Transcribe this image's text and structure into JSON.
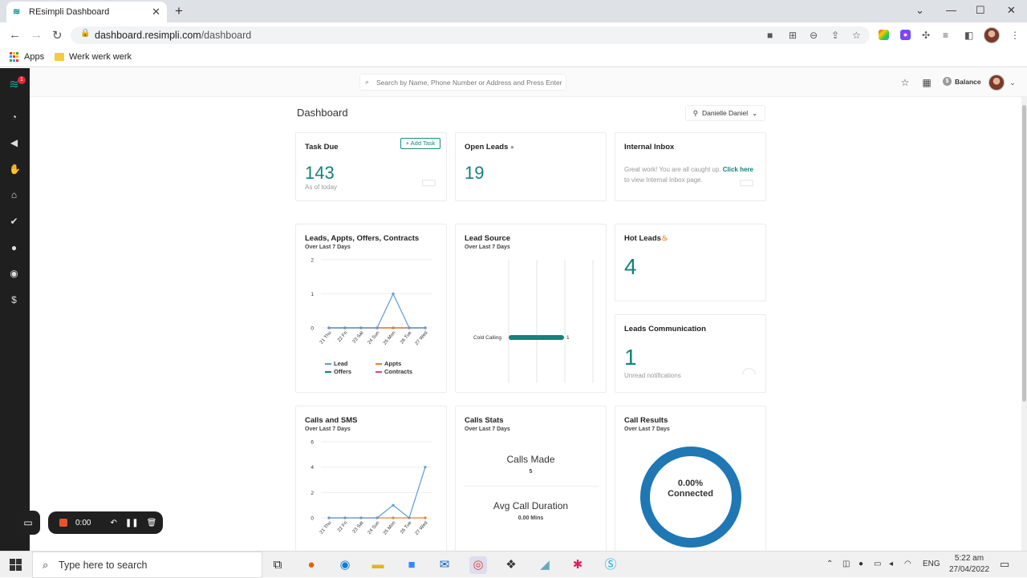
{
  "browser": {
    "tab_title": "REsimpli Dashboard",
    "url_host": "dashboard.resimpli.com",
    "url_path": "/dashboard",
    "bookmarks": [
      {
        "label": "Apps"
      },
      {
        "label": "Werk werk werk"
      }
    ]
  },
  "app": {
    "search_placeholder": "Search by Name, Phone Number or Address and Press Enter",
    "balance_label": "Balance",
    "notification_count": "1",
    "page_title": "Dashboard",
    "user_name": "Danielle Daniel"
  },
  "cards": {
    "task_due": {
      "title": "Task Due",
      "add_label": "+ Add Task",
      "value": "143",
      "sub": "As of today"
    },
    "open_leads": {
      "title": "Open Leads",
      "value": "19"
    },
    "internal_inbox": {
      "title": "Internal Inbox",
      "text_before": "Great work! You are all caught up. ",
      "link": "Click here",
      "text_after": " to view Internal Inbox page."
    },
    "leads_appts": {
      "title": "Leads, Appts, Offers, Contracts",
      "sub": "Over Last 7 Days"
    },
    "lead_source": {
      "title": "Lead Source",
      "sub": "Over Last 7 Days"
    },
    "hot_leads": {
      "title": "Hot Leads",
      "value": "4"
    },
    "leads_comm": {
      "title": "Leads Communication",
      "value": "1",
      "sub": "Unread notifications"
    },
    "calls_sms": {
      "title": "Calls and SMS",
      "sub": "Over Last 7 Days"
    },
    "calls_stats": {
      "title": "Calls Stats",
      "sub": "Over Last 7 Days",
      "made_label": "Calls Made",
      "made_value": "5",
      "duration_label": "Avg Call Duration",
      "duration_value": "0.00 Mins"
    },
    "call_results": {
      "title": "Call Results",
      "sub": "Over Last 7 Days",
      "pct": "0.00%",
      "label": "Connected"
    }
  },
  "chart_data": [
    {
      "type": "line",
      "title": "Leads, Appts, Offers, Contracts",
      "categories": [
        "21 Thu",
        "22 Fri",
        "23 Sat",
        "24 Sun",
        "25 Mon",
        "26 Tue",
        "27 Wed"
      ],
      "ylim": [
        0,
        2
      ],
      "yticks": [
        "0",
        "1",
        "2"
      ],
      "series": [
        {
          "name": "Lead",
          "color": "#5b9bd5",
          "values": [
            0,
            0,
            0,
            0,
            1,
            0,
            0
          ]
        },
        {
          "name": "Appts",
          "color": "#ed7d31",
          "values": [
            0,
            0,
            0,
            0,
            0,
            0,
            0
          ]
        },
        {
          "name": "Offers",
          "color": "#14827a",
          "values": [
            0,
            0,
            0,
            0,
            0,
            0,
            0
          ]
        },
        {
          "name": "Contracts",
          "color": "#e0457b",
          "values": [
            0,
            0,
            0,
            0,
            0,
            0,
            0
          ]
        }
      ]
    },
    {
      "type": "bar",
      "title": "Lead Source",
      "categories": [
        "Cold Calling"
      ],
      "values": [
        1
      ],
      "color": "#14827a"
    },
    {
      "type": "line",
      "title": "Calls and SMS",
      "categories": [
        "21 Thu",
        "22 Fri",
        "23 Sat",
        "24 Sun",
        "25 Mon",
        "26 Tue",
        "27 Wed"
      ],
      "ylim": [
        0,
        6
      ],
      "yticks": [
        "0",
        "2",
        "4",
        "6"
      ],
      "series": [
        {
          "color": "#5b9bd5",
          "values": [
            0,
            0,
            0,
            0,
            1,
            0,
            4
          ]
        },
        {
          "color": "#ed7d31",
          "values": [
            0,
            0,
            0,
            0,
            0,
            0,
            0
          ]
        }
      ]
    },
    {
      "type": "pie",
      "title": "Call Results",
      "values": [
        0
      ],
      "color": "#1f77b4"
    }
  ],
  "recorder": {
    "time": "0:00"
  },
  "taskbar": {
    "search_placeholder": "Type here to search",
    "lang": "ENG",
    "time": "5:22 am",
    "date": "27/04/2022"
  }
}
